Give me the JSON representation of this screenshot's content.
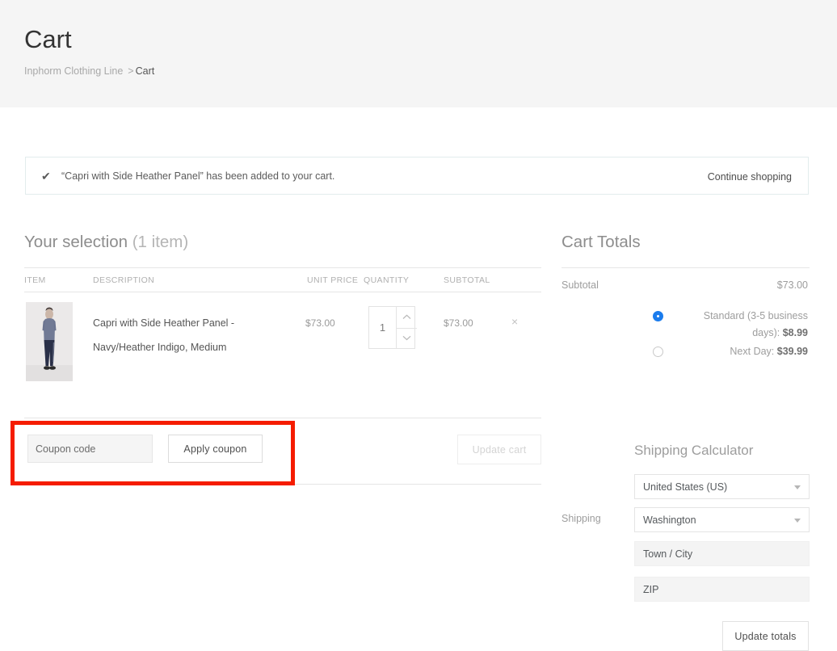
{
  "header": {
    "title": "Cart",
    "breadcrumb": {
      "root": "Inphorm Clothing Line",
      "separator": ">",
      "current": "Cart"
    }
  },
  "notice": {
    "check_icon": "check-icon",
    "message": "“Capri with Side Heather Panel” has been added to your cart.",
    "action_label": "Continue shopping"
  },
  "selection": {
    "title": "Your selection",
    "count_label": "(1 item)",
    "columns": {
      "item": "ITEM",
      "description": "DESCRIPTION",
      "unit_price": "UNIT PRICE",
      "quantity": "QUANTITY",
      "subtotal": "SUBTOTAL"
    },
    "rows": [
      {
        "description": "Capri with Side Heather Panel - Navy/Heather Indigo, Medium",
        "unit_price": "$73.00",
        "quantity": "1",
        "subtotal": "$73.00",
        "remove_icon": "×"
      }
    ],
    "coupon": {
      "placeholder": "Coupon code",
      "value": "",
      "apply_label": "Apply coupon"
    },
    "update_cart_label": "Update cart"
  },
  "totals": {
    "title": "Cart Totals",
    "subtotal_label": "Subtotal",
    "subtotal_value": "$73.00",
    "shipping_label": "Shipping",
    "shipping_options": [
      {
        "label": "Standard (3-5 business days):",
        "price": "$8.99",
        "selected": true
      },
      {
        "label": "Next Day:",
        "price": "$39.99",
        "selected": false
      }
    ],
    "calculator": {
      "title": "Shipping Calculator",
      "country": "United States (US)",
      "state": "Washington",
      "city_placeholder": "Town / City",
      "city_value": "",
      "zip_placeholder": "ZIP",
      "zip_value": "",
      "update_totals_label": "Update totals"
    }
  },
  "annotation": {
    "color": "#f51c00",
    "target": "coupon-area"
  },
  "theme": {
    "header_bg": "#f5f5f5",
    "accent_blue": "#1b7ced",
    "text_muted": "#9d9d9d",
    "annotation_red": "#f51c00"
  }
}
